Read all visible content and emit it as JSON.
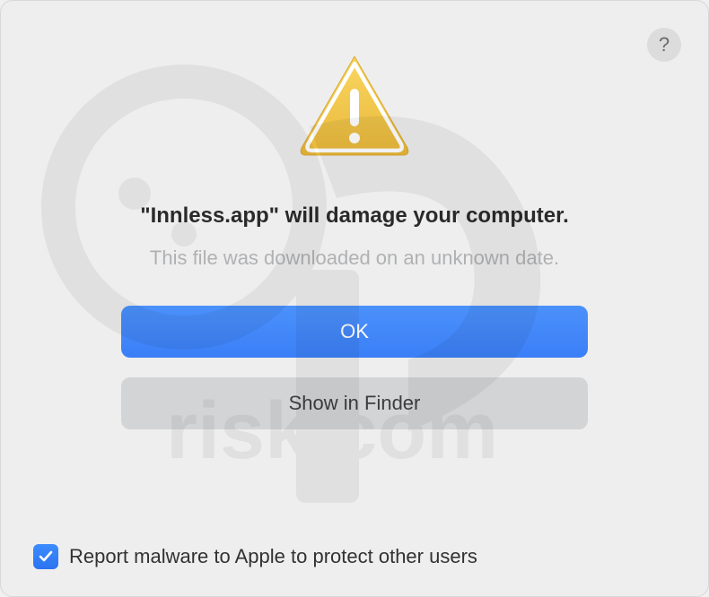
{
  "dialog": {
    "heading": "\"Innless.app\" will damage your computer.",
    "subtext": "This file was downloaded on an unknown date.",
    "primary_button": "OK",
    "secondary_button": "Show in Finder",
    "checkbox_label": "Report malware to Apple to protect other users",
    "checkbox_checked": true,
    "help_label": "?"
  },
  "colors": {
    "accent": "#3b7ff7",
    "background": "#eeeeee"
  }
}
